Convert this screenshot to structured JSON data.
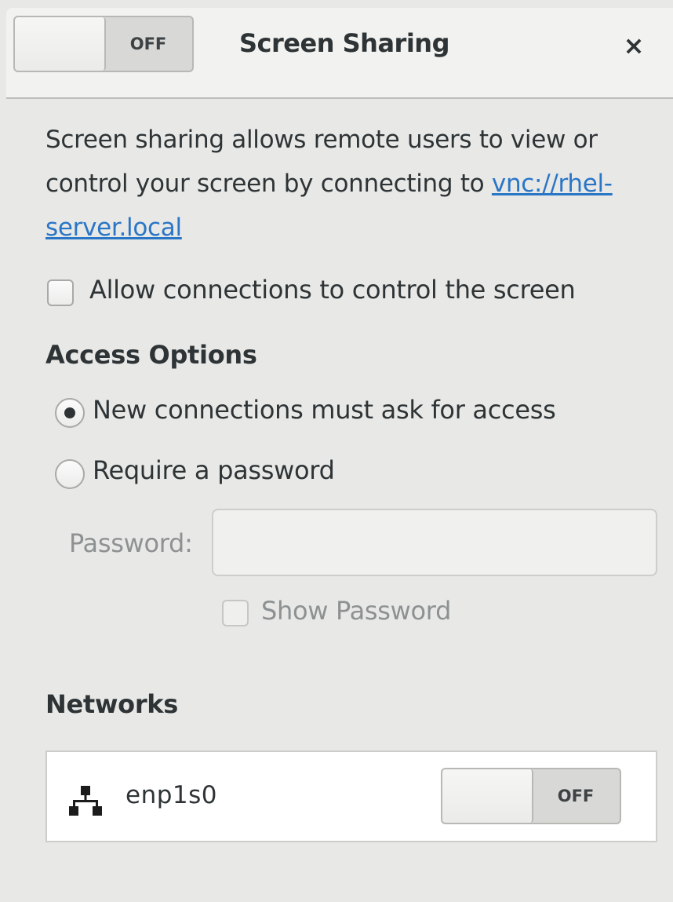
{
  "header": {
    "title": "Screen Sharing",
    "switch_state": "OFF",
    "close_glyph": "×"
  },
  "description": {
    "text": "Screen sharing allows remote users to view or control your screen by connecting to ",
    "link": "vnc://rhel-server.local"
  },
  "allow_control": {
    "label": "Allow connections to control the screen",
    "checked": false
  },
  "access_options": {
    "heading": "Access Options",
    "options": [
      {
        "label": "New connections must ask for access",
        "selected": true
      },
      {
        "label": "Require a password",
        "selected": false
      }
    ],
    "password": {
      "label": "Password:",
      "value": "",
      "show_password_label": "Show Password"
    }
  },
  "networks": {
    "heading": "Networks",
    "items": [
      {
        "name": "enp1s0",
        "icon": "wired-network-icon",
        "switch_state": "OFF"
      }
    ]
  }
}
